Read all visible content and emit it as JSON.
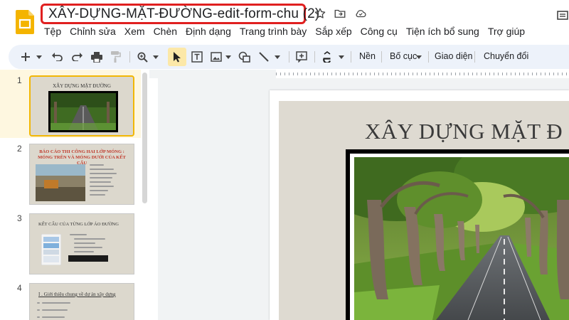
{
  "app": {
    "doc_title": "XÂY-DỰNG-MẶT-ĐƯỜNG-edit-form-chu (2)"
  },
  "menu": {
    "items": [
      "Tệp",
      "Chỉnh sửa",
      "Xem",
      "Chèn",
      "Định dạng",
      "Trang trình bày",
      "Sắp xếp",
      "Công cụ",
      "Tiện ích bổ sung",
      "Trợ giúp"
    ]
  },
  "toolbar": {
    "background_label": "Nền",
    "layout_label": "Bố cục",
    "theme_label": "Giao diện",
    "transition_label": "Chuyển đổi"
  },
  "filmstrip": {
    "slides": [
      {
        "number": "1",
        "title": "XÂY DỰNG MẶT ĐƯỜNG"
      },
      {
        "number": "2",
        "title": "BÁO CÁO THI CÔNG HAI LỚP MÓNG : MÓNG TRÊN VÀ MÓNG DƯỚI CỦA KẾT CẤU"
      },
      {
        "number": "3",
        "title": "KẾT CẤU CỦA TỪNG LỚP ÁO ĐƯỜNG"
      },
      {
        "number": "4",
        "title": "I . Giới thiệu chung về dự án xây dựng"
      }
    ]
  },
  "slide": {
    "title": "XÂY DỰNG MẶT Đ"
  },
  "colors": {
    "accent_yellow": "#f2b705",
    "title_highlight": "#e02020",
    "toolbar_bg": "#edf2fa"
  }
}
